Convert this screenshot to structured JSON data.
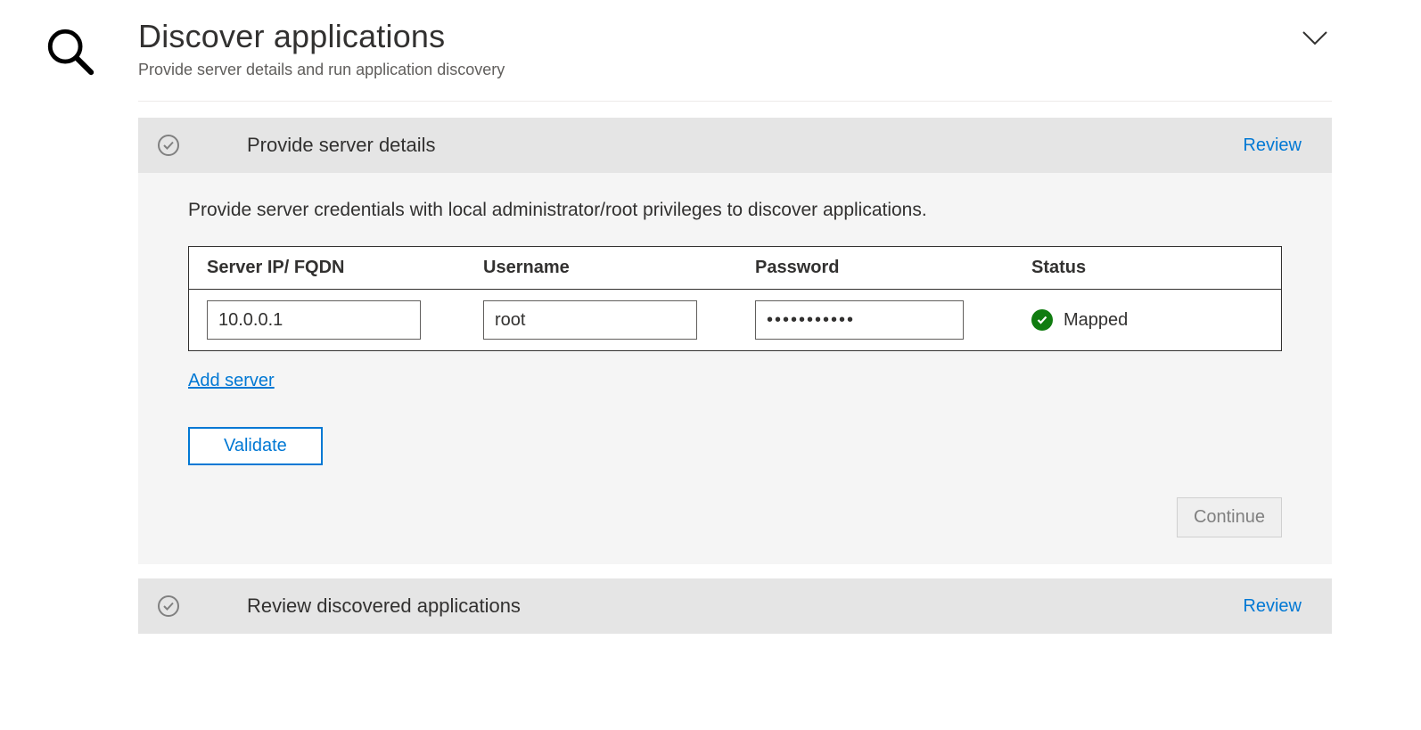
{
  "header": {
    "title": "Discover applications",
    "subtitle": "Provide server details and run application discovery"
  },
  "section1": {
    "title": "Provide server details",
    "review_label": "Review",
    "instruction": "Provide server credentials with local administrator/root privileges to discover applications.",
    "columns": {
      "ip": "Server IP/ FQDN",
      "username": "Username",
      "password": "Password",
      "status": "Status"
    },
    "row": {
      "ip": "10.0.0.1",
      "username": "root",
      "password": "•••••••••••",
      "status": "Mapped"
    },
    "add_server_label": "Add server",
    "validate_label": "Validate",
    "continue_label": "Continue"
  },
  "section2": {
    "title": "Review discovered applications",
    "review_label": "Review"
  }
}
